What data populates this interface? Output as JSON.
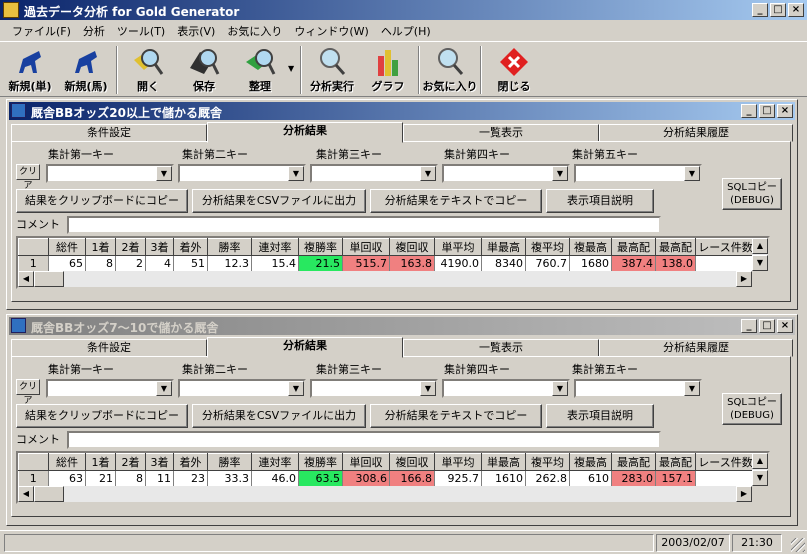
{
  "app": {
    "title": "過去データ分析 for Gold Generator"
  },
  "menu": [
    "ファイル(F)",
    "分析",
    "ツール(T)",
    "表示(V)",
    "お気に入り",
    "ウィンドウ(W)",
    "ヘルプ(H)"
  ],
  "toolbar": {
    "new_single": "新規(単)",
    "new_horse": "新規(馬)",
    "open": "開く",
    "save": "保存",
    "organize": "整理",
    "run_analysis": "分析実行",
    "graph": "グラフ",
    "favorites": "お気に入り",
    "close": "閉じる"
  },
  "tabs": [
    "条件設定",
    "分析結果",
    "一覧表示",
    "分析結果履歴"
  ],
  "keys": [
    "集計第一キー",
    "集計第二キー",
    "集計第三キー",
    "集計第四キー",
    "集計第五キー"
  ],
  "clear_label": "クリア",
  "buttons": {
    "copy_clipboard": "結果をクリップボードにコピー",
    "csv": "分析結果をCSVファイルに出力",
    "text": "分析結果をテキストでコピー",
    "explain": "表示項目説明",
    "sql": "SQLコピー\n(DEBUG)"
  },
  "comment_label": "コメント",
  "columns": [
    "",
    "総件",
    "1着",
    "2着",
    "3着",
    "着外",
    "勝率",
    "連対率",
    "複勝率",
    "単回収",
    "複回収",
    "単平均",
    "単最高",
    "複平均",
    "複最高",
    "最高配",
    "最高配",
    "レース件数"
  ],
  "windows": [
    {
      "title": "厩舎BBオッズ20以上で儲かる厩舎",
      "row": [
        "1",
        "65",
        "8",
        "2",
        "4",
        "51",
        "12.3",
        "15.4",
        "21.5",
        "515.7",
        "163.8",
        "4190.0",
        "8340",
        "760.7",
        "1680",
        "387.4",
        "138.0",
        ""
      ]
    },
    {
      "title": "厩舎BBオッズ7～10で儲かる厩舎",
      "row": [
        "1",
        "63",
        "21",
        "8",
        "11",
        "23",
        "33.3",
        "46.0",
        "63.5",
        "308.6",
        "166.8",
        "925.7",
        "1610",
        "262.8",
        "610",
        "283.0",
        "157.1",
        ""
      ]
    }
  ],
  "status": {
    "date": "2003/02/07",
    "time": "21:30"
  },
  "colors": {
    "good": "#28e860",
    "high": "#f08080",
    "title_active": "#0a246a"
  }
}
